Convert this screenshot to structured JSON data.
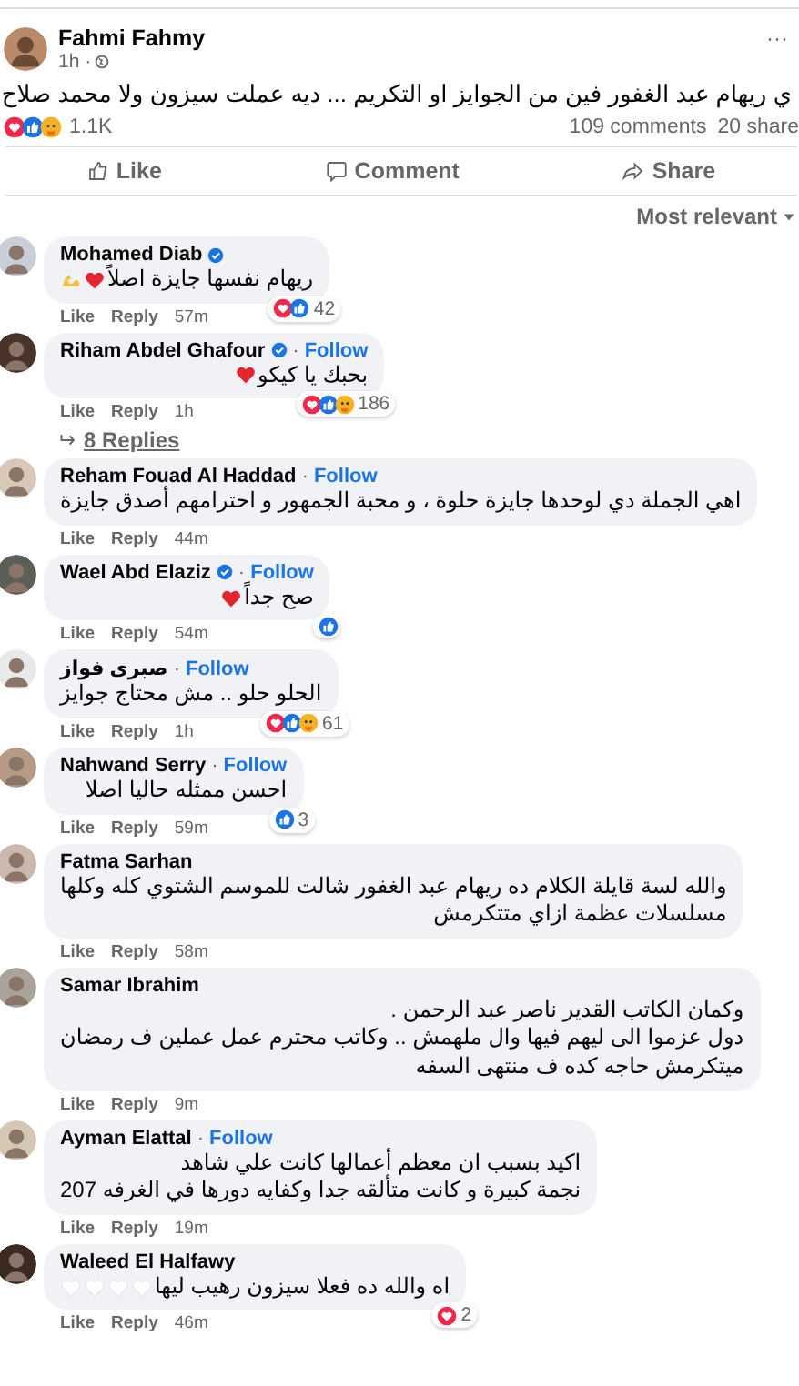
{
  "post": {
    "author": "Fahmi Fahmy",
    "time": "1h ·",
    "more": "···",
    "text": "ي ريهام عبد الغفور فين من الجوايز او التكريم ... ديه عملت سيزون ولا محمد صلاح",
    "reactions": [
      {
        "kind": "love"
      },
      {
        "kind": "like"
      },
      {
        "kind": "care"
      }
    ],
    "reaction_count": "1.1K",
    "comments_count": "109 comments",
    "shares_count": "20 share",
    "actions": [
      "Like",
      "Comment",
      "Share"
    ]
  },
  "sort": "Most relevant",
  "comments": [
    {
      "name": "Mohamed Diab",
      "verified": true,
      "lines": [
        "ريهام نفسها جايزة اصلاً"
      ],
      "emojis": [
        {
          "kind": "heart"
        },
        {
          "kind": "muscle"
        }
      ],
      "reactions": [
        {
          "kind": "love"
        },
        {
          "kind": "like"
        }
      ],
      "reaction_count": "42",
      "actions": [
        "Like",
        "Reply"
      ],
      "time": "57m"
    },
    {
      "name": "Riham Abdel Ghafour",
      "verified": true,
      "separator": "·",
      "follow": "Follow",
      "lines": [
        "بحبك يا كيكو"
      ],
      "emojis": [
        {
          "kind": "heart"
        }
      ],
      "reactions": [
        {
          "kind": "love"
        },
        {
          "kind": "like"
        },
        {
          "kind": "care"
        }
      ],
      "reaction_count": "186",
      "actions": [
        "Like",
        "Reply"
      ],
      "time": "1h",
      "replies": "8 Replies"
    },
    {
      "name": "Reham Fouad Al Haddad",
      "verified": false,
      "separator": "·",
      "follow": "Follow",
      "lines": [
        "اهي الجملة دي لوحدها جايزة حلوة ، و محبة الجمهور و احترامهم أصدق جايزة"
      ],
      "actions": [
        "Like",
        "Reply"
      ],
      "time": "44m"
    },
    {
      "name": "Wael Abd Elaziz",
      "verified": true,
      "separator": "·",
      "follow": "Follow",
      "lines": [
        "صح جداً"
      ],
      "emojis": [
        {
          "kind": "heart"
        }
      ],
      "reactions": [
        {
          "kind": "like"
        }
      ],
      "actions": [
        "Like",
        "Reply"
      ],
      "time": "54m"
    },
    {
      "name": "صبرى فواز",
      "verified": false,
      "separator": "·",
      "follow": "Follow",
      "lines": [
        "الحلو حلو .. مش محتاج جوايز"
      ],
      "reactions": [
        {
          "kind": "love"
        },
        {
          "kind": "like"
        },
        {
          "kind": "care"
        }
      ],
      "reaction_count": "61",
      "actions": [
        "Like",
        "Reply"
      ],
      "time": "1h"
    },
    {
      "name": "Nahwand Serry",
      "verified": false,
      "separator": "·",
      "follow": "Follow",
      "lines": [
        "احسن ممثله حاليا اصلا"
      ],
      "reactions": [
        {
          "kind": "like"
        }
      ],
      "reaction_count": "3",
      "actions": [
        "Like",
        "Reply"
      ],
      "time": "59m"
    },
    {
      "name": "Fatma Sarhan",
      "verified": false,
      "lines": [
        "والله لسة قايلة الكلام ده ريهام عبد الغفور شالت للموسم الشتوي كله وكلها",
        "مسلسلات عظمة ازاي متتكرمش"
      ],
      "actions": [
        "Like",
        "Reply"
      ],
      "time": "58m"
    },
    {
      "name": "Samar Ibrahim",
      "verified": false,
      "lines": [
        "وكمان الكاتب القدير ناصر عبد الرحمن .",
        "دول عزموا الى ليهم فيها وال ملهمش .. وكاتب محترم عمل عملين ف رمضان",
        "ميتكرمش حاجه كده ف منتهى السفه"
      ],
      "actions": [
        "Like",
        "Reply"
      ],
      "time": "9m"
    },
    {
      "name": "Ayman Elattal",
      "verified": false,
      "separator": "·",
      "follow": "Follow",
      "lines": [
        "اكيد بسبب ان معظم أعمالها كانت علي شاهد",
        "نجمة كبيرة و كانت متألقه جدا وكفايه دورها في الغرفه 207"
      ],
      "actions": [
        "Like",
        "Reply"
      ],
      "time": "19m"
    },
    {
      "name": "Waleed El Halfawy",
      "verified": false,
      "lines": [
        "اه والله ده فعلا سيزون رهيب ليها"
      ],
      "emojis": [
        {
          "kind": "white-heart"
        },
        {
          "kind": "white-heart"
        },
        {
          "kind": "white-heart"
        },
        {
          "kind": "white-heart"
        }
      ],
      "reactions": [
        {
          "kind": "love"
        }
      ],
      "reaction_count": "2",
      "actions": [
        "Like",
        "Reply"
      ],
      "time": "46m"
    }
  ]
}
